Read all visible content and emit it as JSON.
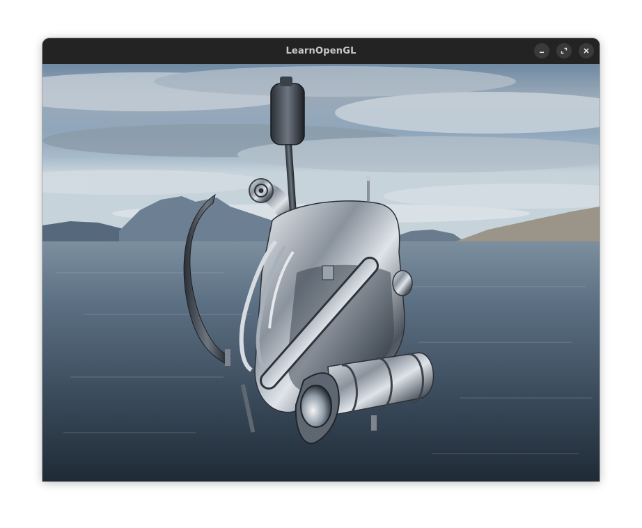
{
  "window": {
    "title": "LearnOpenGL",
    "controls": {
      "minimize_icon": "minimize-icon",
      "maximize_icon": "maximize-icon",
      "close_icon": "close-icon"
    }
  },
  "scene": {
    "description_icon": "opengl-render",
    "sky_top_color": "#5f7f9e",
    "sky_mid_color": "#9fb0bf",
    "water_color": "#3a4a5a",
    "metal_color": "#c8ccd2"
  }
}
